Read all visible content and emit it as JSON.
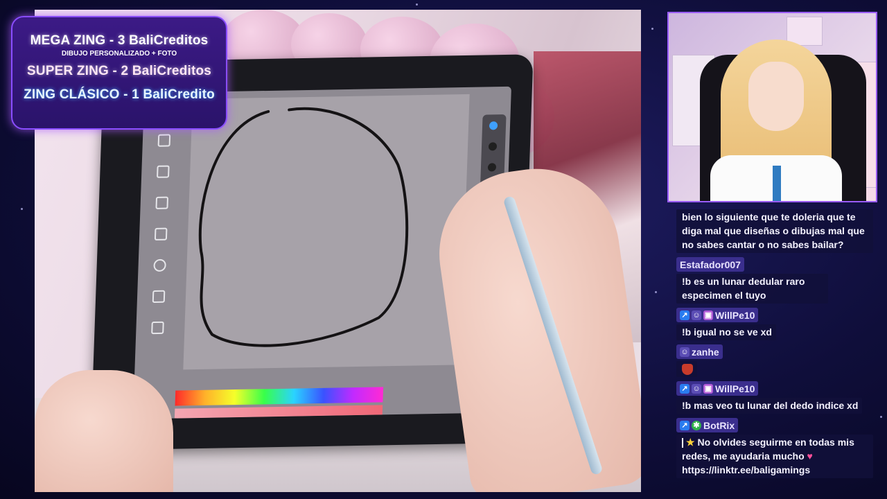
{
  "promo": {
    "line1": "MEGA ZING - 3 BaliCreditos",
    "line1_sub": "DIBUJO PERSONALIZADO + FOTO",
    "line2": "SUPER ZING - 2 BaliCreditos",
    "line3": "ZING CLÁSICO - 1 BaliCredito"
  },
  "chat": {
    "messages": [
      {
        "text": "bien lo siguiente que te doleria que te diga mal que diseñas o dibujas mal que no sabes cantar o no sabes bailar?"
      },
      {
        "user": "Estafador007",
        "text": "!b es un lunar dedular raro especimen el tuyo"
      },
      {
        "user": "WillPe10",
        "badges": [
          "verified-badge",
          "moderator-badge",
          "gift-badge"
        ],
        "text": "!b igual no se ve xd"
      },
      {
        "user": "zanhe",
        "badges": [
          "moderator-badge"
        ],
        "emote": "mask-emote"
      },
      {
        "user": "WillPe10",
        "badges": [
          "verified-badge",
          "moderator-badge",
          "gift-badge"
        ],
        "text": "!b mas veo tu lunar del dedo indice xd"
      },
      {
        "user": "BotRix",
        "badges": [
          "verified-badge",
          "bot-badge"
        ],
        "text_a": "No olvides seguirme en todas mis redes, me ayudaria mucho",
        "text_b": "https://linktr.ee/baligamings"
      }
    ]
  },
  "colors": {
    "background": "#0f0e3a",
    "chat_chip": "#3a2e8d",
    "promo_border": "#8a4dff",
    "webcam_border": "#9a5cff"
  }
}
